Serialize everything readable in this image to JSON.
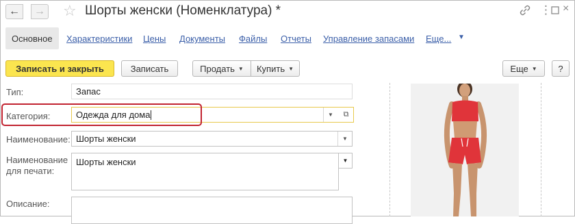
{
  "window": {
    "title": "Шорты женски (Номенклатура) *",
    "icons": [
      "arrow-left-icon",
      "arrow-right-icon",
      "star-icon",
      "link-icon",
      "kebab-icon",
      "maximize-icon",
      "close-icon"
    ]
  },
  "tabs": [
    {
      "label": "Основное",
      "active": true
    },
    {
      "label": "Характеристики"
    },
    {
      "label": "Цены"
    },
    {
      "label": "Документы"
    },
    {
      "label": "Файлы"
    },
    {
      "label": "Отчеты"
    },
    {
      "label": "Управление запасами"
    },
    {
      "label": "Еще..."
    }
  ],
  "toolbar": {
    "save_close": "Записать и закрыть",
    "save": "Записать",
    "sell": "Продать",
    "buy": "Купить",
    "more": "Еще",
    "help": "?"
  },
  "form": {
    "type": {
      "label": "Тип:",
      "value": "Запас"
    },
    "category": {
      "label": "Категория:",
      "value": "Одежда для дома"
    },
    "name": {
      "label": "Наименование:",
      "value": "Шорты женски"
    },
    "print_name": {
      "label_line1": "Наименование",
      "label_line2": "для печати:",
      "value": "Шорты женски"
    },
    "description": {
      "label": "Описание:",
      "value": ""
    }
  },
  "colors": {
    "accent_yellow": "#fbe54f",
    "link_blue": "#3a5ea8",
    "highlight_red": "#c1222f",
    "product_red": "#e0343a"
  }
}
